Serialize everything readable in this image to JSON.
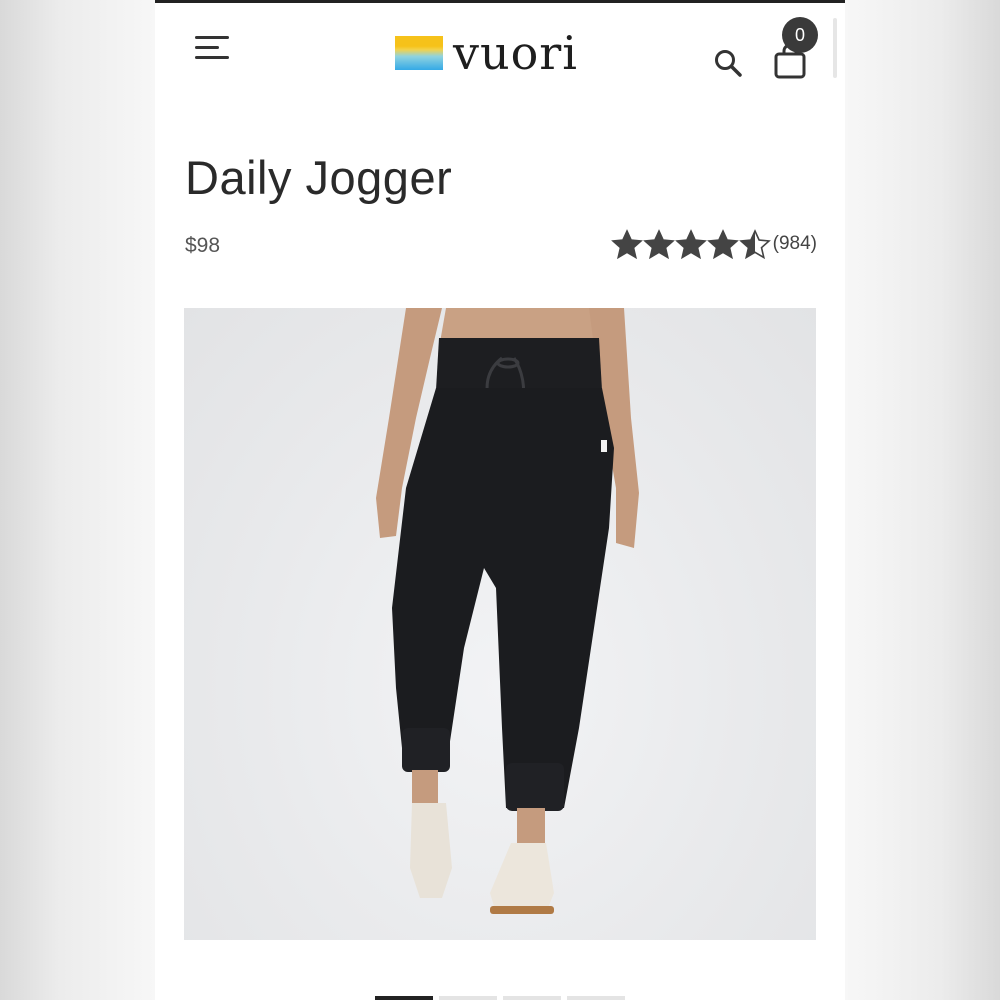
{
  "header": {
    "brand": "vuori",
    "cart_count": "0"
  },
  "product": {
    "title": "Daily Jogger",
    "price": "$98",
    "rating_value": 4.5,
    "rating_max": 5,
    "review_count": "(984)"
  },
  "icons": {
    "menu": "menu-icon",
    "search": "search-icon",
    "cart": "shopping-bag-icon",
    "star": "star-icon"
  },
  "colors": {
    "text": "#2a2a2a",
    "star": "#444444",
    "badge": "#3a3a3a",
    "image_bg": "#e9eaec",
    "logo_yellow": "#f6c21a",
    "logo_blue": "#34a9e6"
  },
  "gallery": {
    "slide_count": 4,
    "active_slide": 1
  }
}
